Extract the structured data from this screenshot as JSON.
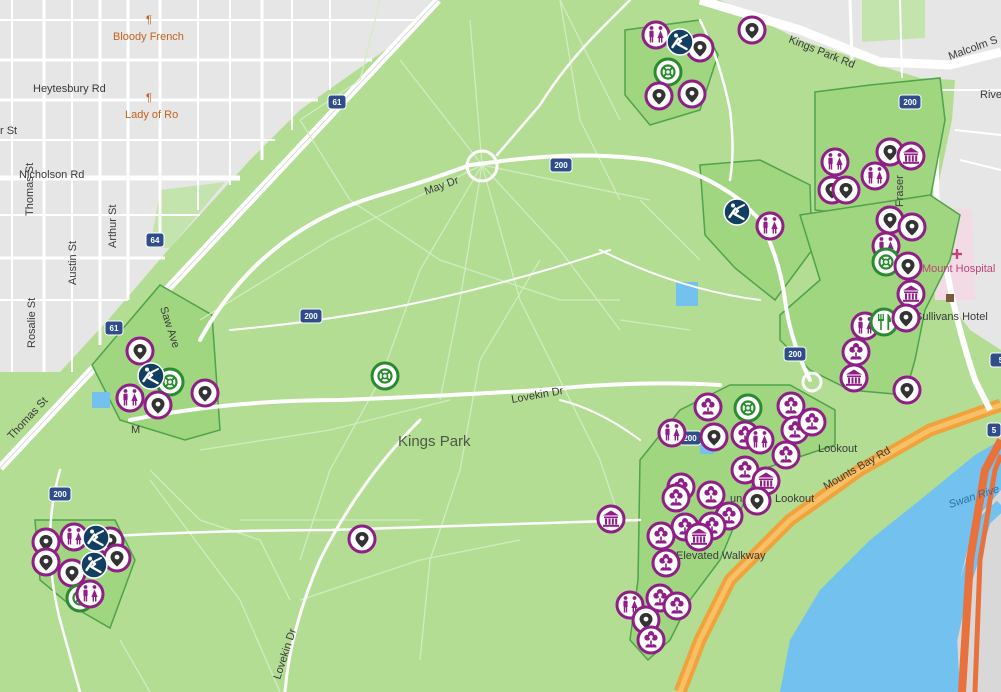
{
  "park": {
    "name": "Kings Park"
  },
  "streets": [
    {
      "id": "bloody-french",
      "text": "Bloody French",
      "kind": "poi-orange"
    },
    {
      "id": "heytesbury",
      "text": "Heytesbury Rd",
      "kind": "street"
    },
    {
      "id": "lady-of-ro",
      "text": "Lady of Ro",
      "kind": "poi-orange"
    },
    {
      "id": "r-st",
      "text": "r St",
      "kind": "street"
    },
    {
      "id": "nicholson",
      "text": "Nicholson Rd",
      "kind": "street"
    },
    {
      "id": "thomas-st-left",
      "text": "Thomas St",
      "kind": "street"
    },
    {
      "id": "arthur",
      "text": "Arthur St",
      "kind": "street"
    },
    {
      "id": "austin",
      "text": "Austin St",
      "kind": "street"
    },
    {
      "id": "rosalie",
      "text": "Rosalie St",
      "kind": "street"
    },
    {
      "id": "thomas-st",
      "text": "Thomas St",
      "kind": "street"
    },
    {
      "id": "saw-ave",
      "text": "Saw Ave",
      "kind": "street"
    },
    {
      "id": "may-dr",
      "text": "May Dr",
      "kind": "street"
    },
    {
      "id": "lovekin-dr",
      "text": "Lovekin Dr",
      "kind": "street"
    },
    {
      "id": "lovekin-dr-2",
      "text": "Lovekin Dr",
      "kind": "street"
    },
    {
      "id": "kings-park-rd",
      "text": "Kings Park Rd",
      "kind": "street"
    },
    {
      "id": "malcolm",
      "text": "Malcolm S",
      "kind": "street"
    },
    {
      "id": "rive",
      "text": "Rive",
      "kind": "street"
    },
    {
      "id": "fraser",
      "text": "Fraser",
      "kind": "street"
    },
    {
      "id": "mount-hospital",
      "text": "Mount Hospital",
      "kind": "poi-pink"
    },
    {
      "id": "sullivans",
      "text": "Sullivans Hotel",
      "kind": "street"
    },
    {
      "id": "mounts-bay",
      "text": "Mounts Bay Rd",
      "kind": "street"
    },
    {
      "id": "swan-river",
      "text": "Swan Rive",
      "kind": "water"
    },
    {
      "id": "lookout-1",
      "text": "Lookout",
      "kind": "street"
    },
    {
      "id": "lookout-2",
      "text": "Lookout",
      "kind": "street"
    },
    {
      "id": "elevated",
      "text": "Elevated Walkway",
      "kind": "street"
    },
    {
      "id": "m-dr",
      "text": "M",
      "kind": "street"
    },
    {
      "id": "un",
      "text": "un",
      "kind": "street"
    },
    {
      "id": "num-00",
      "text": "00",
      "kind": "street"
    }
  ],
  "route_shields": [
    "61",
    "64",
    "61",
    "200",
    "200",
    "200",
    "200",
    "200",
    "200",
    "5"
  ],
  "markers": [
    {
      "type": "toilet"
    },
    {
      "type": "playground"
    },
    {
      "type": "pin"
    },
    {
      "type": "pin"
    },
    {
      "type": "pin"
    },
    {
      "type": "bbq"
    },
    {
      "type": "pin"
    },
    {
      "type": "pin"
    },
    {
      "type": "pin"
    },
    {
      "type": "pin"
    },
    {
      "type": "toilet"
    },
    {
      "type": "pin"
    },
    {
      "type": "museum"
    },
    {
      "type": "toilet"
    },
    {
      "type": "toilet"
    },
    {
      "type": "pin"
    },
    {
      "type": "pin"
    },
    {
      "type": "playground"
    },
    {
      "type": "toilet"
    },
    {
      "type": "pin"
    },
    {
      "type": "pin"
    },
    {
      "type": "pin"
    },
    {
      "type": "bbq"
    },
    {
      "type": "pin"
    },
    {
      "type": "museum"
    },
    {
      "type": "toilet"
    },
    {
      "type": "cafe"
    },
    {
      "type": "pin"
    },
    {
      "type": "flower"
    },
    {
      "type": "museum"
    },
    {
      "type": "pin"
    },
    {
      "type": "pin"
    },
    {
      "type": "playground"
    },
    {
      "type": "bbq"
    },
    {
      "type": "toilet"
    },
    {
      "type": "pin"
    },
    {
      "type": "pin"
    },
    {
      "type": "bbq"
    },
    {
      "type": "toilet"
    },
    {
      "type": "flower"
    },
    {
      "type": "pin"
    },
    {
      "type": "flower"
    },
    {
      "type": "flower"
    },
    {
      "type": "bbq"
    },
    {
      "type": "flower"
    },
    {
      "type": "flower"
    },
    {
      "type": "toilet"
    },
    {
      "type": "flower"
    },
    {
      "type": "flower"
    },
    {
      "type": "flower"
    },
    {
      "type": "museum"
    },
    {
      "type": "pin"
    },
    {
      "type": "flower"
    },
    {
      "type": "flower"
    },
    {
      "type": "flower"
    },
    {
      "type": "flower"
    },
    {
      "type": "flower"
    },
    {
      "type": "flower"
    },
    {
      "type": "flower"
    },
    {
      "type": "flower"
    },
    {
      "type": "museum"
    },
    {
      "type": "toilet"
    },
    {
      "type": "flower"
    },
    {
      "type": "flower"
    },
    {
      "type": "pin"
    },
    {
      "type": "flower"
    },
    {
      "type": "pin"
    },
    {
      "type": "pin"
    },
    {
      "type": "toilet"
    },
    {
      "type": "playground"
    },
    {
      "type": "pin"
    },
    {
      "type": "pin"
    },
    {
      "type": "toilet"
    },
    {
      "type": "pin"
    },
    {
      "type": "bbq"
    },
    {
      "type": "playground"
    },
    {
      "type": "pin"
    },
    {
      "type": "toilet"
    }
  ],
  "colors": {
    "park": "#b2dd92",
    "park_feature": "#9fd67f",
    "park_feature_border": "#4fa34a",
    "urban": "#e6e6e6",
    "water": "#73c1ee",
    "highway": "#f0a23b",
    "freeway": "#e8713c",
    "marker_purple": "#8f1f86",
    "marker_green": "#2a8a2f",
    "marker_navy": "#123e62"
  }
}
